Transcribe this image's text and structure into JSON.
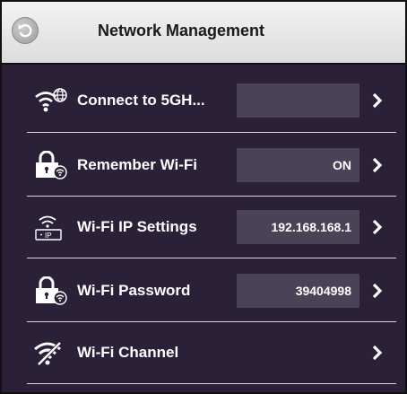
{
  "header": {
    "title": "Network Management",
    "back_icon": "back-arrow-icon"
  },
  "rows": [
    {
      "label": "Connect to 5GH...",
      "value": "",
      "icon": "wifi-globe-icon",
      "has_value_box": true
    },
    {
      "label": "Remember Wi-Fi",
      "value": "ON",
      "icon": "lock-wifi-icon",
      "has_value_box": true
    },
    {
      "label": "Wi-Fi IP Settings",
      "value": "192.168.168.1",
      "icon": "wifi-ip-icon",
      "ip_badge": "IP",
      "has_value_box": true
    },
    {
      "label": "Wi-Fi Password",
      "value": "39404998",
      "icon": "lock-wifi-icon",
      "has_value_box": true
    },
    {
      "label": "Wi-Fi Channel",
      "value": "",
      "icon": "wifi-signal-icon",
      "has_value_box": false
    }
  ],
  "colors": {
    "background": "#2a2139",
    "value_box": "#4a4257",
    "text": "#ffffff",
    "header": "#e6e6e6"
  }
}
